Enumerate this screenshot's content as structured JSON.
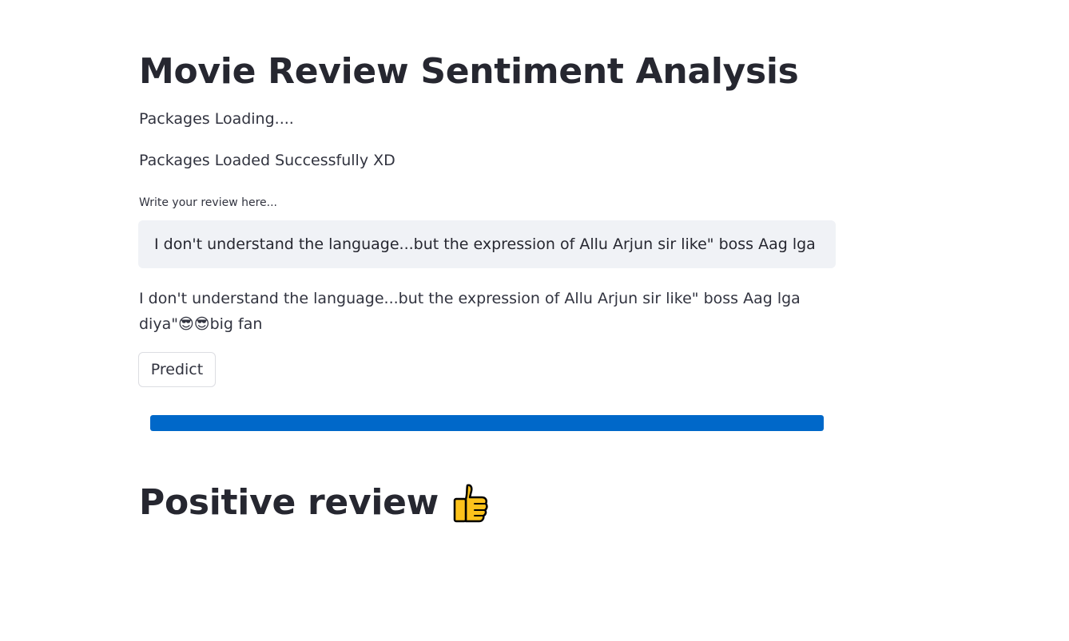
{
  "header": {
    "title": "Movie Review Sentiment Analysis"
  },
  "status": {
    "loading": "Packages Loading....",
    "loaded": "Packages Loaded Successfully XD"
  },
  "review_input": {
    "label": "Write your review here...",
    "value": "I don't understand the language...but the expression of Allu Arjun sir like\" boss Aag lga diya\"😎😎big fan"
  },
  "echo": {
    "text": "I don't understand the language...but the expression of Allu Arjun sir like\" boss Aag lga diya\"😎😎big fan"
  },
  "predict_button": {
    "label": "Predict"
  },
  "progress": {
    "value": 1.0,
    "color": "#0068c9"
  },
  "result": {
    "label": "Positive review",
    "icon": "thumbs-up-icon"
  }
}
